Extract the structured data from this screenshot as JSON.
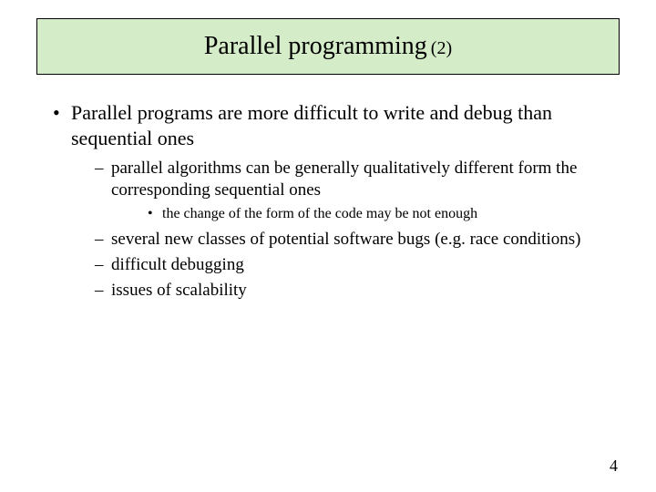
{
  "title": "Parallel programming",
  "title_suffix": "(2)",
  "bullet1": "Parallel programs are more difficult to write and debug than sequential ones",
  "sub": {
    "a": "parallel algorithms can be generally qualitatively different form the corresponding sequential ones",
    "a_sub": "the change of the form of the code may be not enough",
    "b": "several new classes of potential software bugs (e.g. race conditions)",
    "c": "difficult debugging",
    "d": "issues of scalability"
  },
  "page_number": "4"
}
